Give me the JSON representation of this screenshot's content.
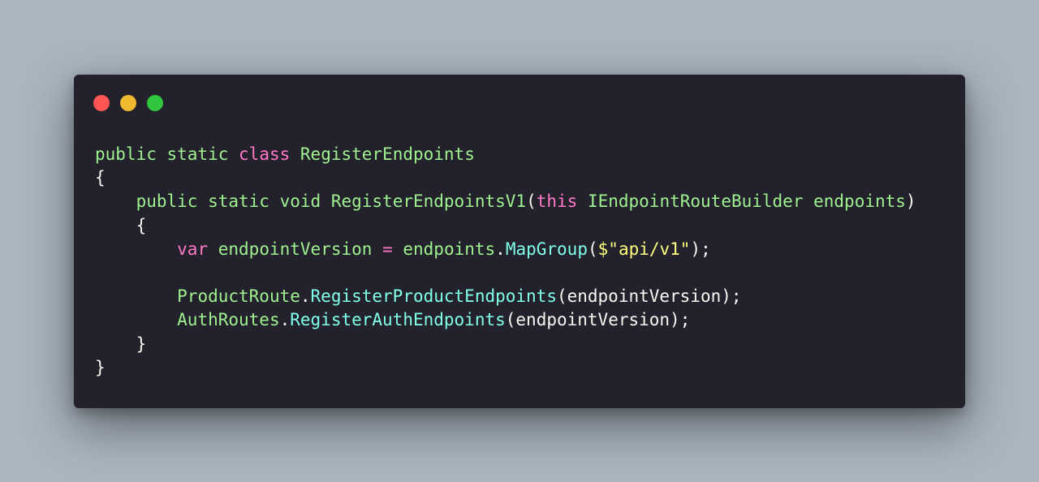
{
  "window": {
    "controls": [
      {
        "name": "close",
        "color": "#ff5555"
      },
      {
        "name": "minimize",
        "color": "#f1b92f"
      },
      {
        "name": "maximize",
        "color": "#2fc53f"
      }
    ]
  },
  "colors": {
    "background": "#aab5c0",
    "editor": "#22212c",
    "keyword_green": "#9ff28f",
    "keyword_pink": "#ff79c6",
    "method_cyan": "#80ffea",
    "string_yellow": "#ffff80",
    "text_white": "#f8f8f2"
  },
  "code": {
    "l1": {
      "t1": "public",
      "t2": "static",
      "t3": "class",
      "t4": "RegisterEndpoints"
    },
    "l2": {
      "t1": "{"
    },
    "l3": {
      "t1": "public",
      "t2": "static",
      "t3": "void",
      "t4": "RegisterEndpointsV1",
      "t5": "(",
      "t6": "this",
      "t7": "IEndpointRouteBuilder",
      "t8": "endpoints",
      "t9": ")"
    },
    "l4": {
      "t1": "{"
    },
    "l5": {
      "t1": "var",
      "t2": "endpointVersion",
      "t3": "=",
      "t4": "endpoints",
      "t5": ".",
      "t6": "MapGroup",
      "t7": "(",
      "t8": "$\"",
      "t9": "api/v1",
      "t10": "\"",
      "t11": ");"
    },
    "l6": {},
    "l7": {
      "t1": "ProductRoute",
      "t2": ".",
      "t3": "RegisterProductEndpoints",
      "t4": "(endpointVersion);"
    },
    "l8": {
      "t1": "AuthRoutes",
      "t2": ".",
      "t3": "RegisterAuthEndpoints",
      "t4": "(endpointVersion);"
    },
    "l9": {
      "t1": "}"
    },
    "l10": {
      "t1": "}"
    }
  }
}
